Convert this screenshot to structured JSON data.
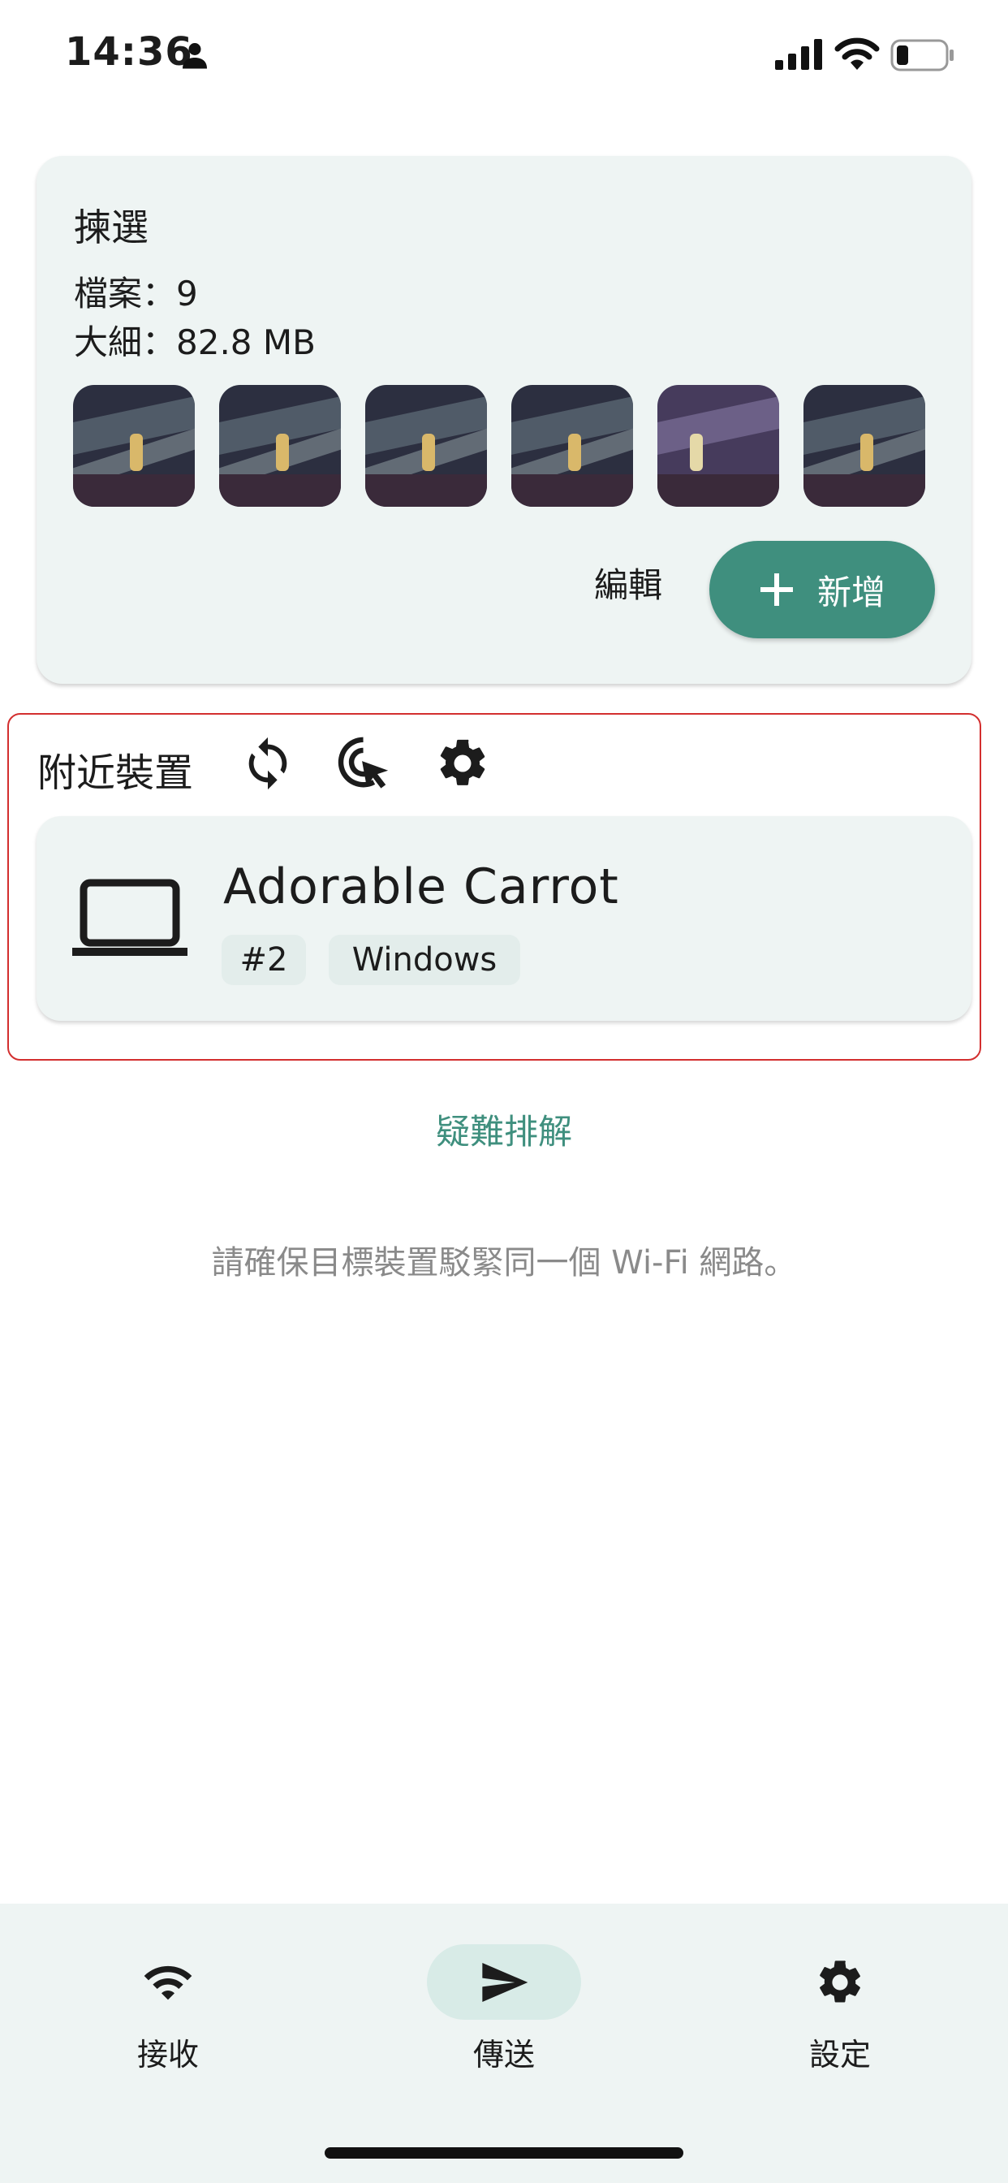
{
  "status_bar": {
    "time": "14:36"
  },
  "selection": {
    "title": "揀選",
    "files": "檔案：9",
    "size": "大細：82.8 MB",
    "thumbnail_count": 6,
    "edit_label": "編輯",
    "add_label": "新增"
  },
  "nearby": {
    "title": "附近裝置",
    "device": {
      "name": "Adorable Carrot",
      "number": "#2",
      "os": "Windows"
    }
  },
  "troubleshoot_label": "疑難排解",
  "hint": "請確保目標裝置駁緊同一個 Wi-Fi 網路。",
  "bottom_nav": {
    "receive": "接收",
    "send": "傳送",
    "settings": "設定"
  },
  "colors": {
    "accent": "#3f8f7e",
    "card_bg": "#eef4f3",
    "highlight_border": "#d32f2f"
  }
}
